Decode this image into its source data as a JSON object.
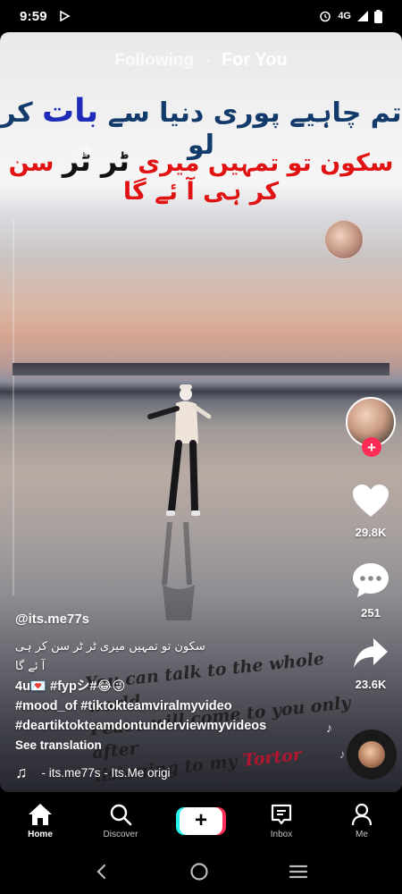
{
  "status_bar": {
    "time": "9:59",
    "network": "4G",
    "icons": [
      "play-protect-icon",
      "alarm-icon",
      "signal-icon",
      "battery-icon"
    ]
  },
  "top_tabs": {
    "following": "Following",
    "for_you": "For You"
  },
  "video_caption": {
    "line1_part1": "تم چاہیے پوری دنیا سے ",
    "line1_highlight": "بات",
    "line1_part2": " کر لو",
    "line2_part1": "سکون تو تمہیں میری ",
    "line2_highlight": "ٹر ٹر",
    "line2_part2": " سن کر ہی آ ئے گا",
    "emoji": "😜"
  },
  "overlay_text": {
    "line1": "You can talk to the whole world",
    "line2": "Peace will come to you only after",
    "line3_part1": "listening to my ",
    "line3_highlight": "Tortor"
  },
  "side_actions": {
    "likes": "29.8K",
    "comments": "251",
    "shares": "23.6K"
  },
  "post": {
    "username": "@its.me77s",
    "description_urdu": "سکون تو تمہیں میری ٹر ٹر سن کر ہی آ ئے گا",
    "description_line1": "4u💌 #fypシ#😂😜",
    "description_line2": "#mood_of #tiktokteamviralmyvideo",
    "description_line3": " #deartiktokteamdontunderviewmyvideos",
    "see_translation": "See translation",
    "music": "- its.me77s - Its.Me    origi"
  },
  "bottom_nav": {
    "home": "Home",
    "discover": "Discover",
    "create": "+",
    "inbox": "Inbox",
    "me": "Me"
  },
  "colors": {
    "accent_red": "#fe2c55",
    "accent_cyan": "#25f4ee",
    "background": "#000000"
  }
}
